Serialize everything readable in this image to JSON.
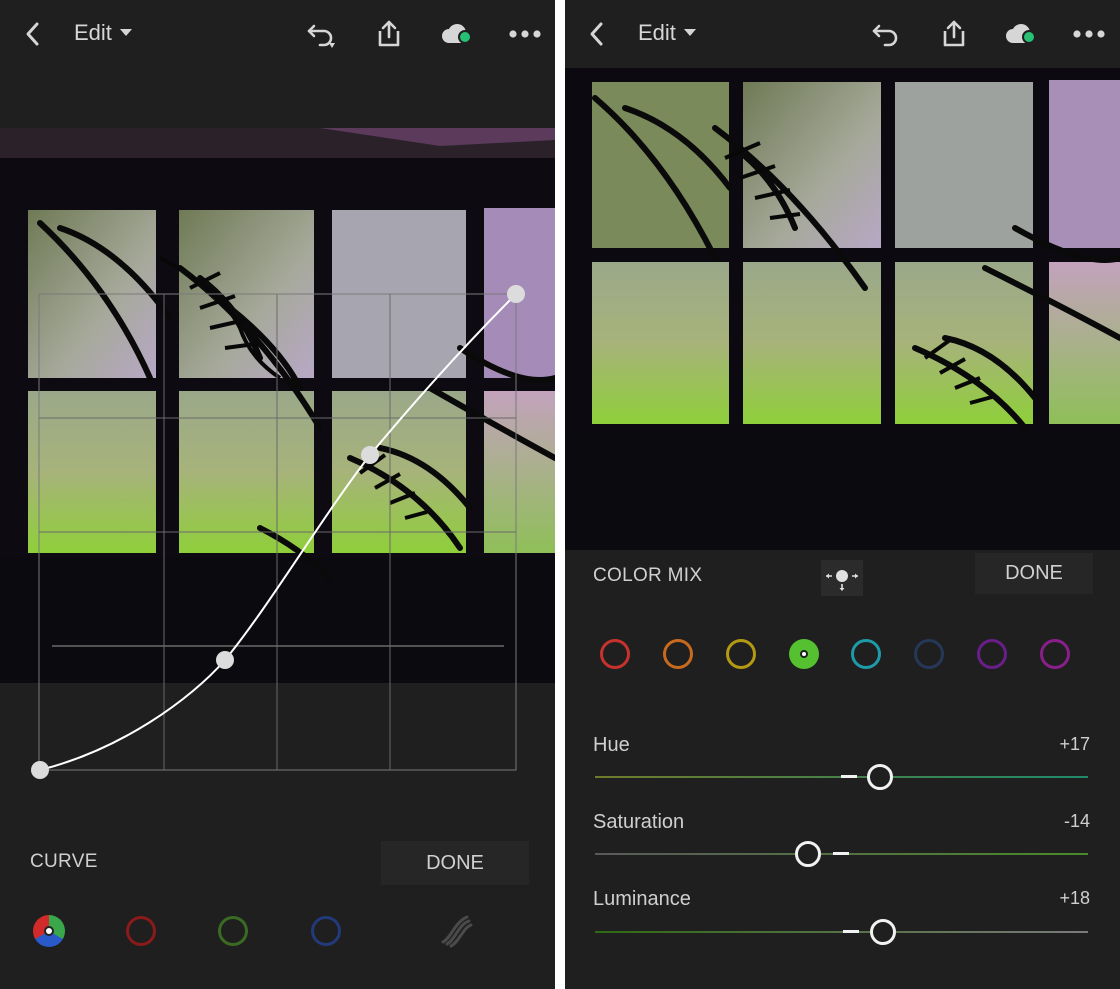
{
  "left": {
    "header": {
      "edit_label": "Edit",
      "icons": [
        "back-icon",
        "undo-icon",
        "share-icon",
        "cloud-sync-icon",
        "more-icon"
      ]
    },
    "curve": {
      "section_label": "CURVE",
      "done_label": "DONE",
      "channels": [
        "rgb",
        "red",
        "green",
        "blue"
      ],
      "channel_colors": {
        "red": "#8b1a1a",
        "green": "#3a6b22",
        "blue": "#223a7a"
      }
    }
  },
  "right": {
    "header": {
      "edit_label": "Edit",
      "icons": [
        "back-icon",
        "undo-icon",
        "share-icon",
        "cloud-sync-icon",
        "more-icon"
      ]
    },
    "color_mix": {
      "section_label": "COLOR MIX",
      "done_label": "DONE",
      "swatches": [
        {
          "name": "red",
          "color": "#c8322e"
        },
        {
          "name": "orange",
          "color": "#c86a1e"
        },
        {
          "name": "yellow",
          "color": "#b39a12"
        },
        {
          "name": "green",
          "color": "#55c030",
          "selected": true
        },
        {
          "name": "aqua",
          "color": "#1e9aa8"
        },
        {
          "name": "blue",
          "color": "#263858"
        },
        {
          "name": "purple",
          "color": "#6a1e8a"
        },
        {
          "name": "magenta",
          "color": "#8a1e8a"
        }
      ],
      "sliders": [
        {
          "label": "Hue",
          "value": "+17"
        },
        {
          "label": "Saturation",
          "value": "-14"
        },
        {
          "label": "Luminance",
          "value": "+18"
        }
      ]
    }
  }
}
